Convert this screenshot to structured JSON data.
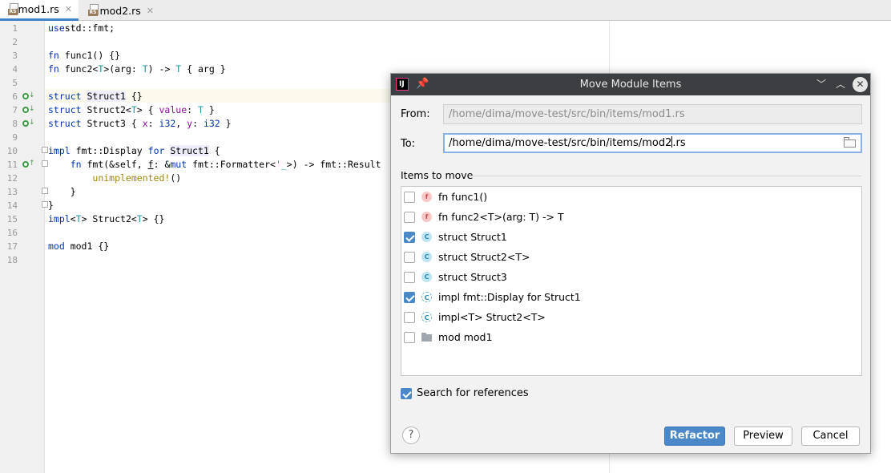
{
  "tabs": [
    {
      "label": "mod1.rs",
      "icon": "rust-file-icon",
      "active": true
    },
    {
      "label": "mod2.rs",
      "icon": "rust-file-icon",
      "active": false
    }
  ],
  "editor": {
    "line_numbers": [
      "1",
      "2",
      "3",
      "4",
      "5",
      "6",
      "7",
      "8",
      "9",
      "10",
      "11",
      "12",
      "13",
      "14",
      "15",
      "16",
      "17",
      "18"
    ]
  },
  "dialog": {
    "title": "Move Module Items",
    "from_label": "From:",
    "from_value": "/home/dima/move-test/src/bin/items/mod1.rs",
    "to_label": "To:",
    "to_value_before_caret": "/home/dima/move-test/src/bin/items/mod2",
    "to_value_after_caret": ".rs",
    "items_label": "Items to move",
    "items": [
      {
        "label": "fn func1()",
        "kind": "f",
        "checked": false
      },
      {
        "label": "fn func2<T>(arg: T) -> T",
        "kind": "f",
        "checked": false
      },
      {
        "label": "struct Struct1",
        "kind": "c",
        "checked": true
      },
      {
        "label": "struct Struct2<T>",
        "kind": "c",
        "checked": false
      },
      {
        "label": "struct Struct3",
        "kind": "c",
        "checked": false
      },
      {
        "label": "impl fmt::Display for Struct1",
        "kind": "i",
        "checked": true
      },
      {
        "label": "impl<T> Struct2<T>",
        "kind": "i",
        "checked": false
      },
      {
        "label": "mod mod1",
        "kind": "m",
        "checked": false
      }
    ],
    "search_refs_label": "Search for references",
    "search_refs_checked": true,
    "help_label": "?",
    "refactor_label": "Refactor",
    "preview_label": "Preview",
    "cancel_label": "Cancel"
  },
  "colors": {
    "accent": "#4a88c7",
    "titlebar": "#3c3f41"
  }
}
